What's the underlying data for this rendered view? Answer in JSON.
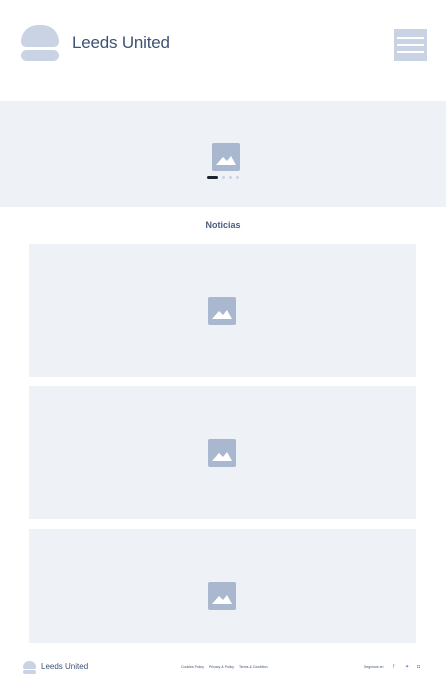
{
  "header": {
    "brand": "Leeds United",
    "menu_icon": "hamburger-menu-icon"
  },
  "hero": {
    "image_icon": "image-placeholder-icon",
    "carousel": {
      "slide_count": 4,
      "active_index": 0
    }
  },
  "news": {
    "title": "Noticias",
    "cards": [
      {
        "image_icon": "image-placeholder-icon"
      },
      {
        "image_icon": "image-placeholder-icon"
      },
      {
        "image_icon": "image-placeholder-icon"
      }
    ]
  },
  "footer": {
    "brand": "Leeds United",
    "links": [
      "Cookies Policy",
      "Privacy & Policy",
      "Terms & Condition"
    ],
    "follow_label": "Seguinos en",
    "social_icons": [
      "facebook-icon",
      "twitter-icon",
      "instagram-icon"
    ],
    "social_glyphs": [
      "f",
      "✦",
      "◘"
    ]
  },
  "colors": {
    "placeholder_bg": "#eef1f6",
    "placeholder_icon": "#a9b7cf",
    "logo": "#c9d3e3",
    "text": "#3d5275",
    "active_dot": "#1c2434",
    "social": "#5a7fc0"
  }
}
